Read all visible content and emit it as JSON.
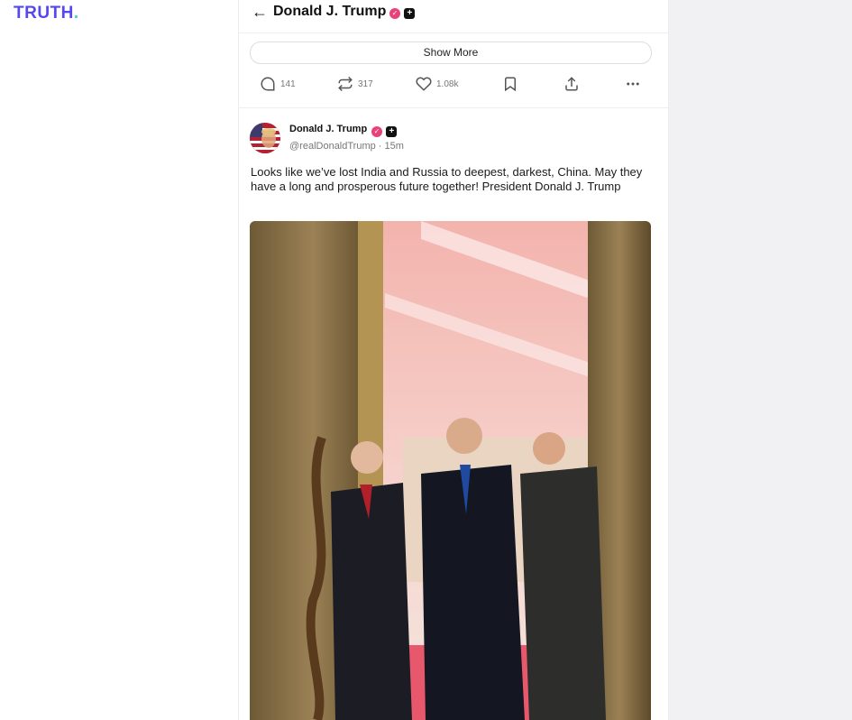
{
  "brand": {
    "name": "TRUTH",
    "dot": "."
  },
  "header": {
    "title": "Donald J. Trump"
  },
  "show_more_label": "Show More",
  "actions": {
    "replies": "141",
    "retruths": "317",
    "likes": "1.08k"
  },
  "post": {
    "author": "Donald J. Trump",
    "handle": "@realDonaldTrump · 15m",
    "text": "Looks like we’ve lost India and Russia to deepest, darkest, China. May they have a long and prosperous future together! President Donald J. Trump"
  },
  "colors": {
    "brand": "#5448ee",
    "verified": "#e8427a",
    "background_panel": "#f1f1f4"
  }
}
